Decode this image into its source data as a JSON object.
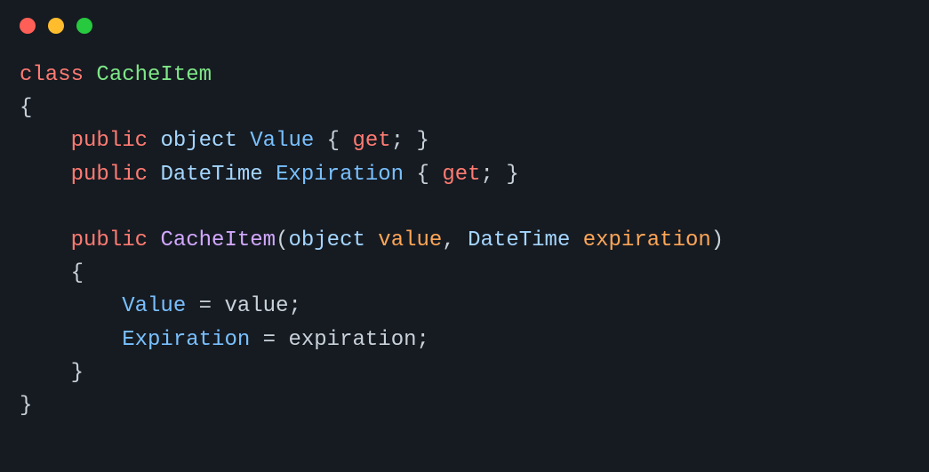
{
  "titlebar": {
    "dots": [
      "close",
      "minimize",
      "zoom"
    ]
  },
  "code": {
    "language": "csharp",
    "lines": [
      [
        {
          "t": "class ",
          "c": "tok-key"
        },
        {
          "t": "CacheItem",
          "c": "tok-name"
        }
      ],
      [
        {
          "t": "{",
          "c": "tok-plain"
        }
      ],
      [
        {
          "t": "    ",
          "c": "tok-plain"
        },
        {
          "t": "public ",
          "c": "tok-key"
        },
        {
          "t": "object ",
          "c": "tok-type1"
        },
        {
          "t": "Value",
          "c": "tok-member"
        },
        {
          "t": " { ",
          "c": "tok-plain"
        },
        {
          "t": "get",
          "c": "tok-accessor"
        },
        {
          "t": "; }",
          "c": "tok-plain"
        }
      ],
      [
        {
          "t": "    ",
          "c": "tok-plain"
        },
        {
          "t": "public ",
          "c": "tok-key"
        },
        {
          "t": "DateTime ",
          "c": "tok-type1"
        },
        {
          "t": "Expiration",
          "c": "tok-member"
        },
        {
          "t": " { ",
          "c": "tok-plain"
        },
        {
          "t": "get",
          "c": "tok-accessor"
        },
        {
          "t": "; }",
          "c": "tok-plain"
        }
      ],
      [
        {
          "t": "",
          "c": "tok-plain"
        }
      ],
      [
        {
          "t": "    ",
          "c": "tok-plain"
        },
        {
          "t": "public ",
          "c": "tok-key"
        },
        {
          "t": "CacheItem",
          "c": "tok-ctor"
        },
        {
          "t": "(",
          "c": "tok-plain"
        },
        {
          "t": "object ",
          "c": "tok-type1"
        },
        {
          "t": "value",
          "c": "tok-param"
        },
        {
          "t": ", ",
          "c": "tok-plain"
        },
        {
          "t": "DateTime ",
          "c": "tok-type1"
        },
        {
          "t": "expiration",
          "c": "tok-param"
        },
        {
          "t": ")",
          "c": "tok-plain"
        }
      ],
      [
        {
          "t": "    {",
          "c": "tok-plain"
        }
      ],
      [
        {
          "t": "        ",
          "c": "tok-plain"
        },
        {
          "t": "Value",
          "c": "tok-member"
        },
        {
          "t": " = ",
          "c": "tok-plain"
        },
        {
          "t": "value",
          "c": "tok-plain"
        },
        {
          "t": ";",
          "c": "tok-plain"
        }
      ],
      [
        {
          "t": "        ",
          "c": "tok-plain"
        },
        {
          "t": "Expiration",
          "c": "tok-member"
        },
        {
          "t": " = ",
          "c": "tok-plain"
        },
        {
          "t": "expiration",
          "c": "tok-plain"
        },
        {
          "t": ";",
          "c": "tok-plain"
        }
      ],
      [
        {
          "t": "    }",
          "c": "tok-plain"
        }
      ],
      [
        {
          "t": "}",
          "c": "tok-plain"
        }
      ]
    ]
  },
  "colors": {
    "background": "#161b22",
    "keyword": "#ff7b72",
    "type": "#a5d6ff",
    "className": "#7ee787",
    "constructor": "#d2a8ff",
    "member": "#79c0ff",
    "param": "#ffa657",
    "plain": "#c9d1d9"
  }
}
